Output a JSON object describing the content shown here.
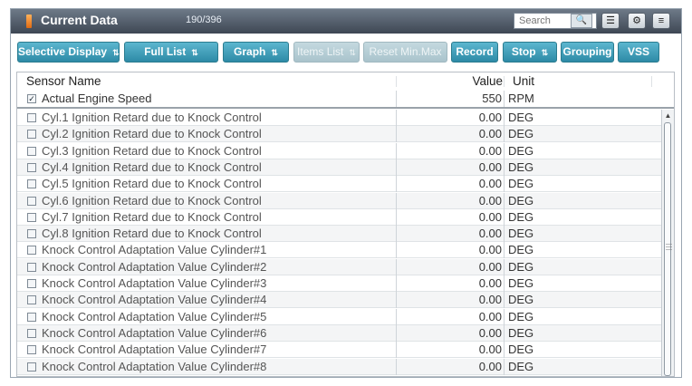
{
  "window": {
    "title": "Current Data",
    "count": "190/396",
    "search_placeholder": "Search",
    "icons": [
      "search-icon",
      "list-icon",
      "settings-icon",
      "menu-icon"
    ]
  },
  "toolbar": {
    "buttons": [
      {
        "label": "Selective Display",
        "has_arrow": true,
        "enabled": true
      },
      {
        "label": "Full List",
        "has_arrow": true,
        "enabled": true
      },
      {
        "label": "Graph",
        "has_arrow": true,
        "enabled": true
      },
      {
        "label": "Items List",
        "has_arrow": true,
        "enabled": false
      },
      {
        "label": "Reset Min.Max",
        "has_arrow": false,
        "enabled": false
      },
      {
        "label": "Record",
        "has_arrow": false,
        "enabled": true
      },
      {
        "label": "Stop",
        "has_arrow": true,
        "enabled": true
      },
      {
        "label": "Grouping",
        "has_arrow": false,
        "enabled": true
      },
      {
        "label": "VSS",
        "has_arrow": false,
        "enabled": true
      }
    ]
  },
  "table": {
    "columns": {
      "name": "Sensor Name",
      "value": "Value",
      "unit": "Unit"
    },
    "pinned_row": {
      "name": "Actual Engine Speed",
      "value": "550",
      "unit": "RPM",
      "checked": true
    },
    "rows": [
      {
        "name": "Cyl.1 Ignition Retard due to Knock Control",
        "value": "0.00",
        "unit": "DEG"
      },
      {
        "name": "Cyl.2 Ignition Retard due to Knock Control",
        "value": "0.00",
        "unit": "DEG"
      },
      {
        "name": "Cyl.3 Ignition Retard due to Knock Control",
        "value": "0.00",
        "unit": "DEG"
      },
      {
        "name": "Cyl.4 Ignition Retard due to Knock Control",
        "value": "0.00",
        "unit": "DEG"
      },
      {
        "name": "Cyl.5 Ignition Retard due to Knock Control",
        "value": "0.00",
        "unit": "DEG"
      },
      {
        "name": "Cyl.6 Ignition Retard due to Knock Control",
        "value": "0.00",
        "unit": "DEG"
      },
      {
        "name": "Cyl.7 Ignition Retard due to Knock Control",
        "value": "0.00",
        "unit": "DEG"
      },
      {
        "name": "Cyl.8 Ignition Retard due to Knock Control",
        "value": "0.00",
        "unit": "DEG"
      },
      {
        "name": "Knock Control Adaptation Value Cylinder#1",
        "value": "0.00",
        "unit": "DEG"
      },
      {
        "name": "Knock Control Adaptation Value Cylinder#2",
        "value": "0.00",
        "unit": "DEG"
      },
      {
        "name": "Knock Control Adaptation Value Cylinder#3",
        "value": "0.00",
        "unit": "DEG"
      },
      {
        "name": "Knock Control Adaptation Value Cylinder#4",
        "value": "0.00",
        "unit": "DEG"
      },
      {
        "name": "Knock Control Adaptation Value Cylinder#5",
        "value": "0.00",
        "unit": "DEG"
      },
      {
        "name": "Knock Control Adaptation Value Cylinder#6",
        "value": "0.00",
        "unit": "DEG"
      },
      {
        "name": "Knock Control Adaptation Value Cylinder#7",
        "value": "0.00",
        "unit": "DEG"
      },
      {
        "name": "Knock Control Adaptation Value Cylinder#8",
        "value": "0.00",
        "unit": "DEG"
      }
    ]
  }
}
